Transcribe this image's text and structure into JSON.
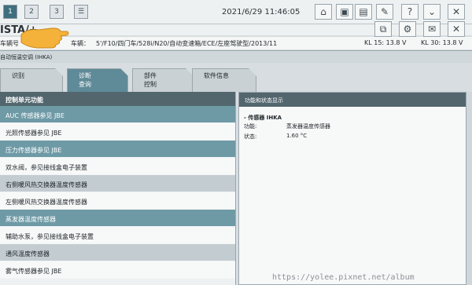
{
  "toolbar": {
    "tabs": [
      "1",
      "2",
      "3"
    ],
    "datetime": "2021/6/29 11:46:05",
    "help_label": "?",
    "close_label": "✕"
  },
  "title": {
    "app": "ISTA/+"
  },
  "vehicle": {
    "prefix": "车辆号",
    "label": "车辆：",
    "info": "5'/F10/四门车/528i/N20/自动变速箱/ECE/左座驾驶型/2013/11",
    "kl15": "KL 15:  13.8 V",
    "kl30": "KL 30:  13.8 V"
  },
  "module": {
    "name": "自动恒温空调 (IHKA)"
  },
  "tabs": [
    {
      "label1": "识别",
      "label2": ""
    },
    {
      "label1": "诊断",
      "label2": "查询"
    },
    {
      "label1": "部件",
      "label2": "控制"
    },
    {
      "label1": "软件信息",
      "label2": ""
    }
  ],
  "left_panel": {
    "header": "控制单元功能",
    "items": [
      "AUC 传感器参见 JBE",
      "光照传感器参见 JBE",
      "压力传感器参见 JBE",
      "双水阀，参见接线盒电子装置",
      "右侧暖风热交换器温度传感器",
      "左侧暖风热交换器温度传感器",
      "蒸发器温度传感器",
      "辅助水泵，参见接线盒电子装置",
      "通风温度传感器",
      "雾气传感器参见 JBE"
    ]
  },
  "right_panel": {
    "header": "功能和状态显示",
    "sensor_title": "- 传感器 IHKA",
    "function_label": "功能:",
    "function_value": "蒸发器温度传感器",
    "status_label": "状态:",
    "status_value": "1.60 °C"
  },
  "watermark": "https://yolee.pixnet.net/album"
}
